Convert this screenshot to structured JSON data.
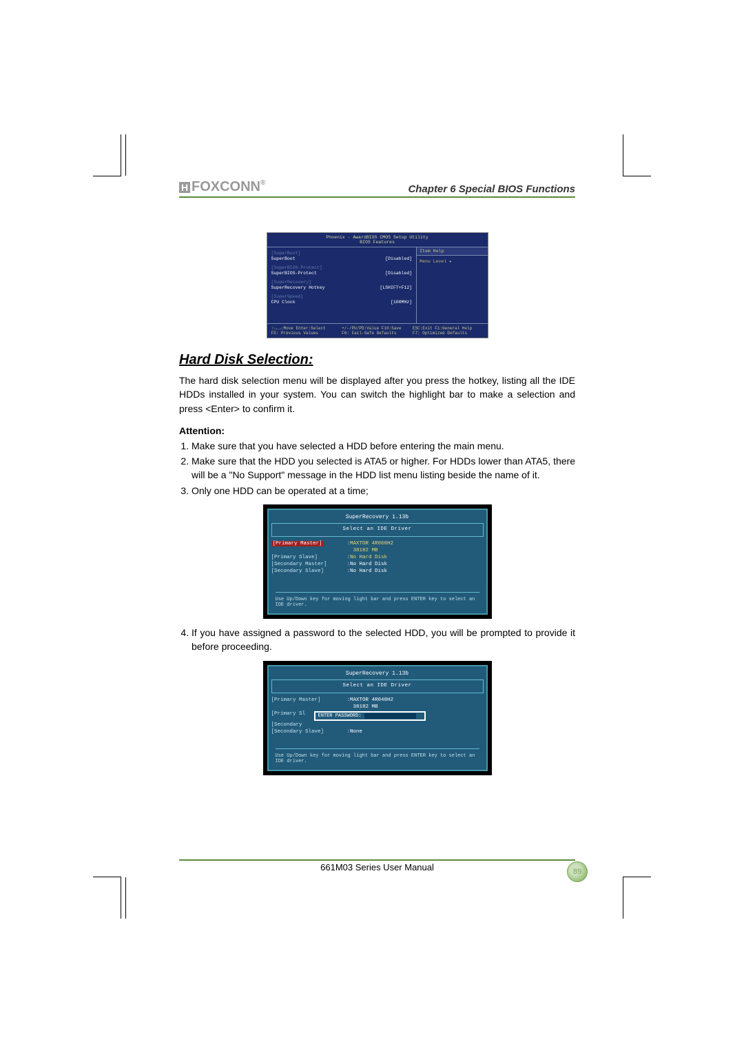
{
  "header": {
    "logo_text": "FOXCONN",
    "chapter": "Chapter 6    Special BIOS Functions"
  },
  "bios": {
    "title1": "Phoenix - AwardBIOS CMOS Setup Utility",
    "title2": "BIOS Features",
    "right_head": "Item Help",
    "right_menu": "Menu Level    ▸",
    "rows": [
      {
        "sec": "[SuperBoot]",
        "lab": "SuperBoot",
        "val": "[Disabled]"
      },
      {
        "sec": "[SuperBIOS-Protect]",
        "lab": "SuperBIOS-Protect",
        "val": "[Disabled]"
      },
      {
        "sec": "[SuperRecovery]",
        "lab": "SuperRecovery Hotkey",
        "val": "[LSHIFT+F12]"
      },
      {
        "sec": "[SuperSpeed]",
        "lab": "CPU Clock",
        "val": "[100MHz]"
      }
    ],
    "foot": {
      "a": "↑↓←→:Move  Enter:Select",
      "b": "+/-/PU/PD:Value  F10:Save",
      "c": "ESC:Exit  F1:General Help",
      "d": "F5: Previous Values",
      "e": "F6: Fail-Safe Defaults",
      "f": "F7: Optimized Defaults"
    }
  },
  "section_title": "Hard Disk Selection:",
  "intro": "The hard disk selection menu will be displayed after you press the hotkey, listing all the IDE HDDs installed in your system. You can switch the highlight bar to make a selection and press <Enter> to confirm it.",
  "attention_label": "Attention:",
  "attention_items": [
    "Make sure that you have selected a HDD before entering the main menu.",
    "Make sure that the HDD you selected is ATA5 or higher. For HDDs lower than ATA5, there will be a \"No Support\" message in the HDD list menu listing beside the name of it.",
    "Only one HDD can be operated at a time;"
  ],
  "sr1": {
    "title": "SuperRecovery 1.13b",
    "select": "Select an IDE Driver",
    "rows": [
      {
        "k": "[Primary Master]",
        "v": "MAXTOR 4R060H2",
        "y": true,
        "hi": true
      },
      {
        "k": "",
        "v": "38182 MB",
        "y": true
      },
      {
        "k": "[Primary Slave]",
        "v": "No Hard Disk",
        "y": true
      },
      {
        "k": "[Secondary Master]",
        "v": "No Hard Disk"
      },
      {
        "k": "[Secondary Slave]",
        "v": "No Hard Disk"
      }
    ],
    "footer": "Use Up/Down key for moving light bar and press ENTER key to select an IDE driver."
  },
  "after_sr1": "If you have assigned a password to the selected HDD, you will be prompted to provide it before proceeding.",
  "sr2": {
    "title": "SuperRecovery 1.13b",
    "select": "Select an IDE Driver",
    "rows": [
      {
        "k": "[Primary Master]",
        "v": "MAXTOR 4R040H2"
      },
      {
        "k": "",
        "v": "38182 MB"
      }
    ],
    "pw_label": "ENTER PASSWORD:",
    "row_ps": "[Primary Sl",
    "row_sec": "[Secondary",
    "row_last_k": "[Secondary Slave]",
    "row_last_v": "None",
    "footer": "Use Up/Down key for moving light bar and press ENTER key to select an IDE driver."
  },
  "footer": {
    "text": "661M03 Series User Manual",
    "page": "89"
  }
}
